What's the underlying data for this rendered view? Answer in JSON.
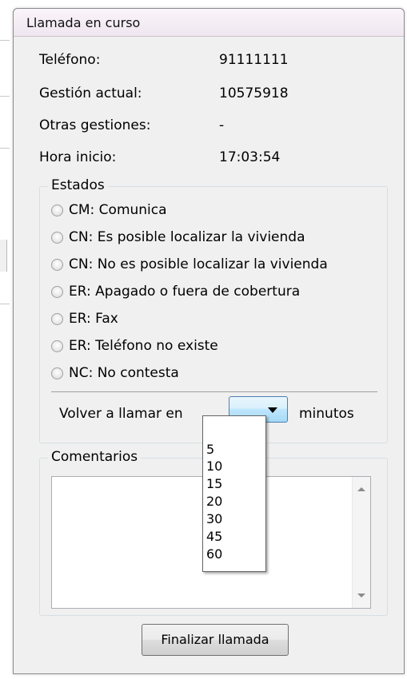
{
  "window": {
    "title": "Llamada en curso"
  },
  "info": [
    {
      "label": "Teléfono:",
      "value": "91111111"
    },
    {
      "label": "Gestión actual:",
      "value": "10575918"
    },
    {
      "label": "Otras gestiones:",
      "value": "-"
    },
    {
      "label": "Hora inicio:",
      "value": "17:03:54"
    }
  ],
  "estados": {
    "legend": "Estados",
    "options": [
      "CM: Comunica",
      "CN: Es posible localizar la vivienda",
      "CN: No es posible localizar la vivienda",
      "ER: Apagado o fuera de cobertura",
      "ER: Fax",
      "ER: Teléfono no existe",
      "NC: No contesta"
    ],
    "selected": null
  },
  "rellamada": {
    "prefix_label": "Volver a llamar en",
    "selected_value": "",
    "suffix_label": "minutos",
    "options": [
      "",
      "5",
      "10",
      "15",
      "20",
      "30",
      "45",
      "60"
    ],
    "dropdown_open": true
  },
  "comentarios": {
    "legend": "Comentarios",
    "value": ""
  },
  "actions": {
    "finalizar_label": "Finalizar llamada"
  },
  "colors": {
    "window_bg": "#f0f0f0",
    "combo_gradient_top": "#eaf6fd",
    "combo_gradient_bottom": "#a7d9f5",
    "group_border": "#d5dfe5"
  }
}
